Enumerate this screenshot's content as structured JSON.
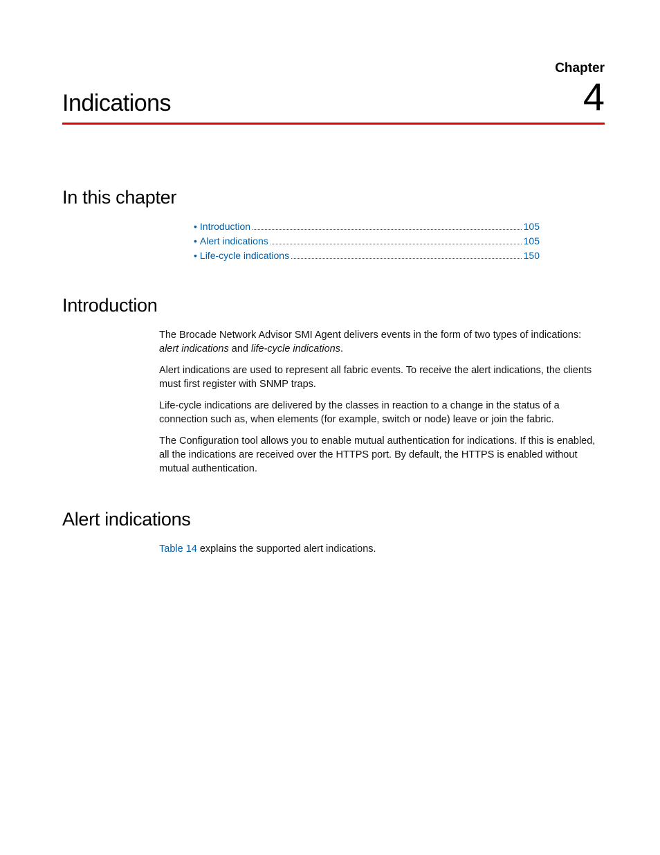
{
  "chapter": {
    "label": "Chapter",
    "number": "4",
    "title": "Indications"
  },
  "sections": {
    "in_this_chapter": "In this chapter",
    "introduction": "Introduction",
    "alert_indications": "Alert indications"
  },
  "toc": [
    {
      "label": "Introduction",
      "page": "105"
    },
    {
      "label": "Alert indications",
      "page": "105"
    },
    {
      "label": "Life-cycle indications",
      "page": "150"
    }
  ],
  "intro": {
    "p1_a": "The Brocade Network Advisor SMI Agent delivers events in the form of two types of indications: ",
    "p1_i1": "alert indications",
    "p1_b": " and ",
    "p1_i2": "life-cycle indications",
    "p1_c": ".",
    "p2": "Alert indications are used to represent all fabric events. To receive the alert indications, the clients must first register with SNMP traps.",
    "p3": "Life-cycle indications are delivered by the classes in reaction to a change in the status of a connection such as, when elements (for example, switch or node) leave or join the fabric.",
    "p4": "The Configuration tool allows you to enable mutual authentication for indications. If this is enabled, all the indications are received over the HTTPS port. By default, the HTTPS is enabled without mutual authentication."
  },
  "alert": {
    "xref": "Table 14",
    "rest": " explains the supported alert indications."
  }
}
